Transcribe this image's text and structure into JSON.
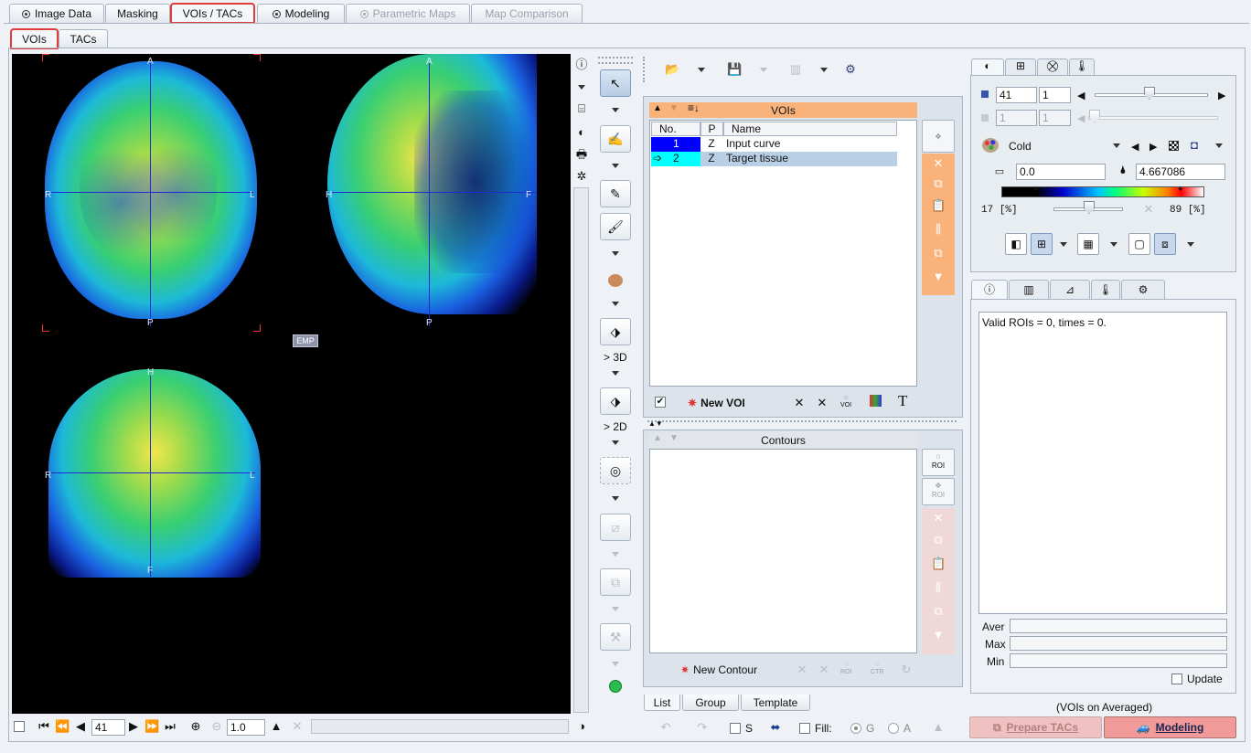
{
  "main_tabs": [
    {
      "label": "Image Data",
      "radio": true,
      "enabled": true
    },
    {
      "label": "Masking",
      "radio": false,
      "enabled": true
    },
    {
      "label": "VOIs / TACs",
      "radio": false,
      "enabled": true,
      "selected": true
    },
    {
      "label": "Modeling",
      "radio": true,
      "enabled": true
    },
    {
      "label": "Parametric Maps",
      "radio": true,
      "enabled": false
    },
    {
      "label": "Map Comparison",
      "radio": false,
      "enabled": false
    }
  ],
  "sub_tabs": [
    {
      "label": "VOIs",
      "selected": true
    },
    {
      "label": "TACs",
      "selected": false
    }
  ],
  "viewer": {
    "axial": {
      "top": "A",
      "bottom": "P",
      "left": "R",
      "right": "L"
    },
    "sagittal": {
      "top": "A",
      "bottom": "P",
      "left": "H",
      "right": "F"
    },
    "coronal": {
      "top": "H",
      "bottom": "F",
      "left": "R",
      "right": "L"
    },
    "badge": "EMP",
    "slice_value": "41",
    "zoom_value": "1.0"
  },
  "tools": {
    "to3d": "> 3D",
    "to2d": "> 2D"
  },
  "voi_panel": {
    "header": "VOIs",
    "columns": [
      "No.",
      "P",
      "Name"
    ],
    "rows": [
      {
        "no": "1",
        "p": "Z",
        "name": "Input curve",
        "color": "#0000ff",
        "selected": false
      },
      {
        "no": "2",
        "p": "Z",
        "name": "Target tissue",
        "color": "#00ffff",
        "selected": true
      }
    ],
    "new_voi": "New VOI",
    "voi_icon_label": "VOI",
    "text_icon": "T"
  },
  "contours_panel": {
    "header": "Contours",
    "new_contour": "New Contour",
    "roi_label": "ROI",
    "ctr_label": "CTR"
  },
  "bottom_tabs": [
    "List",
    "Group",
    "Template"
  ],
  "bottom_bar": {
    "s_label": "S",
    "fill_label": "Fill:",
    "g_label": "G",
    "a_label": "A"
  },
  "color_panel": {
    "field1": "41",
    "field2": "1",
    "field3": "1",
    "field4": "1",
    "colormap": "Cold",
    "min": "0.0",
    "max": "4.667086",
    "pct_min": "17",
    "pct_max": "89",
    "pct_unit": "[%]"
  },
  "stats_panel": {
    "message": "Valid ROIs = 0, times = 0.",
    "aver": "Aver",
    "max": "Max",
    "min": "Min",
    "update": "Update"
  },
  "footer": {
    "vois_on": "(VOIs on Averaged)",
    "prepare": "Prepare TACs",
    "modeling": "Modeling"
  },
  "colors": {
    "accent_header": "#f9b27a",
    "selected_row": "#b9cfe6",
    "highlight": "#e23b3b"
  }
}
